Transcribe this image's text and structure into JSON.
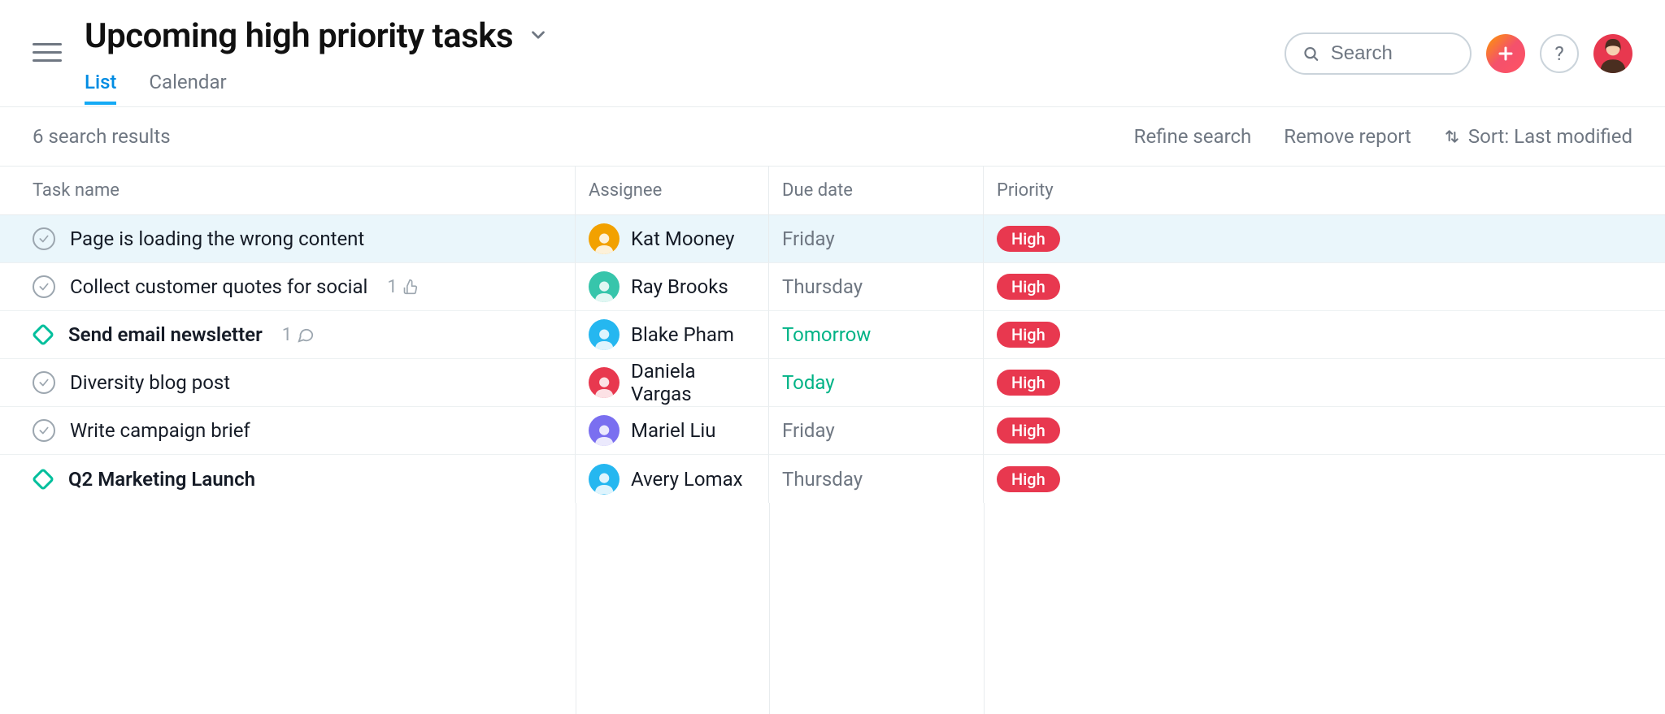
{
  "header": {
    "title": "Upcoming high priority tasks",
    "tabs": [
      {
        "label": "List",
        "active": true
      },
      {
        "label": "Calendar",
        "active": false
      }
    ]
  },
  "search": {
    "placeholder": "Search"
  },
  "toolbar": {
    "results_text": "6 search results",
    "refine_label": "Refine search",
    "remove_label": "Remove report",
    "sort_label": "Sort: Last modified"
  },
  "columns": {
    "task": "Task name",
    "assignee": "Assignee",
    "due": "Due date",
    "priority": "Priority"
  },
  "avatar_colors": [
    "#f2a100",
    "#37c5ab",
    "#25b7f0",
    "#e8384f",
    "#7a6ff0",
    "#25b7f0"
  ],
  "rows": [
    {
      "type": "task",
      "name": "Page is loading the wrong content",
      "bold": false,
      "highlight": true,
      "assignee": "Kat Mooney",
      "due": "Friday",
      "due_soon": false,
      "priority": "High",
      "likes": null,
      "comments": null
    },
    {
      "type": "task",
      "name": "Collect customer quotes for social",
      "bold": false,
      "highlight": false,
      "assignee": "Ray Brooks",
      "due": "Thursday",
      "due_soon": false,
      "priority": "High",
      "likes": "1",
      "comments": null
    },
    {
      "type": "milestone",
      "name": "Send email newsletter",
      "bold": true,
      "highlight": false,
      "assignee": "Blake Pham",
      "due": "Tomorrow",
      "due_soon": true,
      "priority": "High",
      "likes": null,
      "comments": "1"
    },
    {
      "type": "task",
      "name": "Diversity blog post",
      "bold": false,
      "highlight": false,
      "assignee": "Daniela Vargas",
      "due": "Today",
      "due_soon": true,
      "priority": "High",
      "likes": null,
      "comments": null
    },
    {
      "type": "task",
      "name": "Write campaign brief",
      "bold": false,
      "highlight": false,
      "assignee": "Mariel Liu",
      "due": "Friday",
      "due_soon": false,
      "priority": "High",
      "likes": null,
      "comments": null
    },
    {
      "type": "milestone",
      "name": "Q2 Marketing Launch",
      "bold": true,
      "highlight": false,
      "assignee": "Avery Lomax",
      "due": "Thursday",
      "due_soon": false,
      "priority": "High",
      "likes": null,
      "comments": null
    }
  ]
}
